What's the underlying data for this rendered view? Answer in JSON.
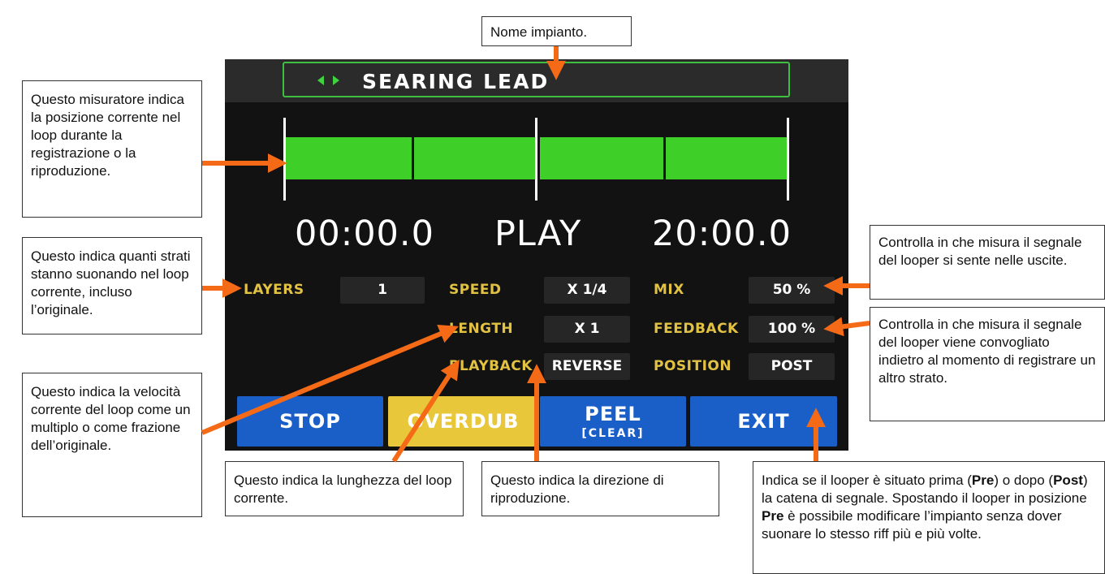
{
  "callouts": {
    "preset_name": "Nome impianto.",
    "meter": "Questo misuratore indica la posizione corrente nel loop durante la registrazione o la riproduzione.",
    "layers": "Questo indica quanti strati stanno suonando nel loop corrente, incluso l’originale.",
    "speed": "Questo indica la velocità corrente del loop come un multiplo o come frazione dell’originale.",
    "length": "Questo indica la lunghezza del loop corrente.",
    "playback": "Questo indica la direzione di riproduzione.",
    "mix": "Controlla in che misura il segnale del looper si sente nelle uscite.",
    "feedback": "Controlla in che misura il segnale del looper viene convogliato indietro al momento di registrare un altro strato.",
    "position": {
      "t1": "Indica se il looper è situato prima (",
      "b1": "Pre",
      "t2": ") o dopo (",
      "b2": "Post",
      "t3": ") la catena di segnale. Spostando il looper in posizione ",
      "b3": "Pre",
      "t4": " è possibile modificare l’impianto senza dover suonare lo stesso riff più e più volte."
    }
  },
  "screen": {
    "preset_name": "SEARING LEAD",
    "nav_icons": [
      "arrow-left-icon",
      "arrow-right-icon"
    ],
    "time_current": "00:00.0",
    "state": "PLAY",
    "time_total": "20:00.0",
    "loop_progress": 1.0,
    "params": {
      "layers": {
        "label": "LAYERS",
        "value": "1"
      },
      "speed": {
        "label": "SPEED",
        "value": "X 1/4"
      },
      "mix": {
        "label": "MIX",
        "value": "50 %"
      },
      "length": {
        "label": "LENGTH",
        "value": "X 1"
      },
      "feedback": {
        "label": "FEEDBACK",
        "value": "100 %"
      },
      "playback": {
        "label": "PLAYBACK",
        "value": "REVERSE"
      },
      "position": {
        "label": "POSITION",
        "value": "POST"
      }
    },
    "buttons": {
      "stop": "STOP",
      "overdub": "OVERDUB",
      "peel": "PEEL",
      "peel_sub": "[CLEAR]",
      "exit": "EXIT"
    }
  },
  "colors": {
    "accent_green": "#3fcf29",
    "label_yellow": "#e2c243",
    "button_blue": "#1a5fc8",
    "button_yellow": "#e8c83a",
    "arrow_orange": "#f56a16"
  }
}
